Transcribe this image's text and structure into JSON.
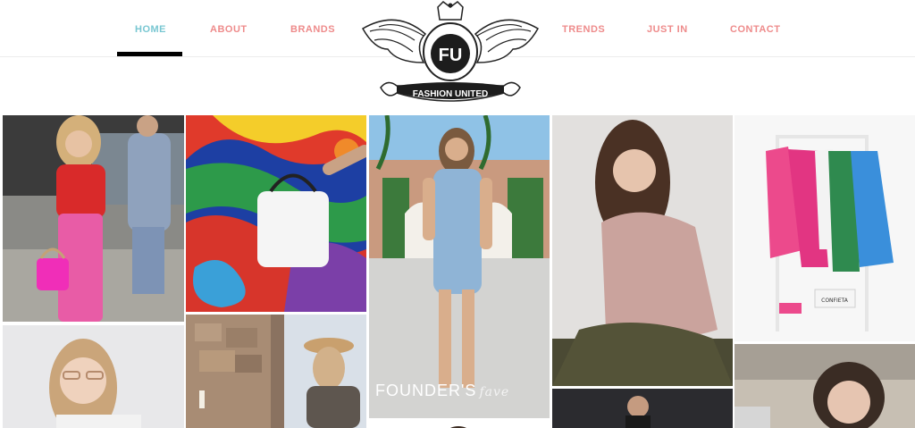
{
  "nav": {
    "left": [
      {
        "label": "HOME",
        "active": true
      },
      {
        "label": "ABOUT",
        "active": false
      },
      {
        "label": "BRANDS",
        "active": false
      }
    ],
    "right": [
      {
        "label": "TRENDS",
        "active": false
      },
      {
        "label": "JUST IN",
        "active": false
      },
      {
        "label": "CONTACT",
        "active": false
      }
    ]
  },
  "logo": {
    "monogram": "FU",
    "wordmark": "FASHION UNITED"
  },
  "tiles": {
    "founders": {
      "title_main": "FOUNDER'S",
      "title_script": "fave"
    },
    "rack_sign": "CONFIETA"
  },
  "colors": {
    "nav_text": "#ee8b8b",
    "nav_active": "#79c7d2",
    "underline": "#000000"
  }
}
